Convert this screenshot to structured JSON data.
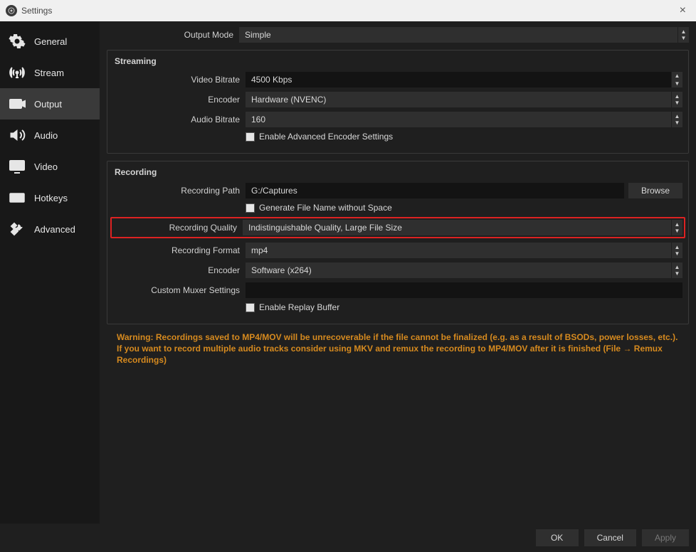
{
  "window": {
    "title": "Settings"
  },
  "sidebar": {
    "items": [
      {
        "label": "General"
      },
      {
        "label": "Stream"
      },
      {
        "label": "Output"
      },
      {
        "label": "Audio"
      },
      {
        "label": "Video"
      },
      {
        "label": "Hotkeys"
      },
      {
        "label": "Advanced"
      }
    ]
  },
  "output": {
    "output_mode_label": "Output Mode",
    "output_mode_value": "Simple",
    "streaming": {
      "title": "Streaming",
      "video_bitrate_label": "Video Bitrate",
      "video_bitrate_value": "4500 Kbps",
      "encoder_label": "Encoder",
      "encoder_value": "Hardware (NVENC)",
      "audio_bitrate_label": "Audio Bitrate",
      "audio_bitrate_value": "160",
      "enable_advanced_label": "Enable Advanced Encoder Settings"
    },
    "recording": {
      "title": "Recording",
      "path_label": "Recording Path",
      "path_value": "G:/Captures",
      "browse_label": "Browse",
      "gen_filename_label": "Generate File Name without Space",
      "quality_label": "Recording Quality",
      "quality_value": "Indistinguishable Quality, Large File Size",
      "format_label": "Recording Format",
      "format_value": "mp4",
      "encoder_label": "Encoder",
      "encoder_value": "Software (x264)",
      "muxer_label": "Custom Muxer Settings",
      "muxer_value": "",
      "enable_replay_label": "Enable Replay Buffer"
    },
    "warning_text": "Warning: Recordings saved to MP4/MOV will be unrecoverable if the file cannot be finalized (e.g. as a result of BSODs, power losses, etc.). If you want to record multiple audio tracks consider using MKV and remux the recording to MP4/MOV after it is finished (File → Remux Recordings)"
  },
  "footer": {
    "ok": "OK",
    "cancel": "Cancel",
    "apply": "Apply"
  }
}
